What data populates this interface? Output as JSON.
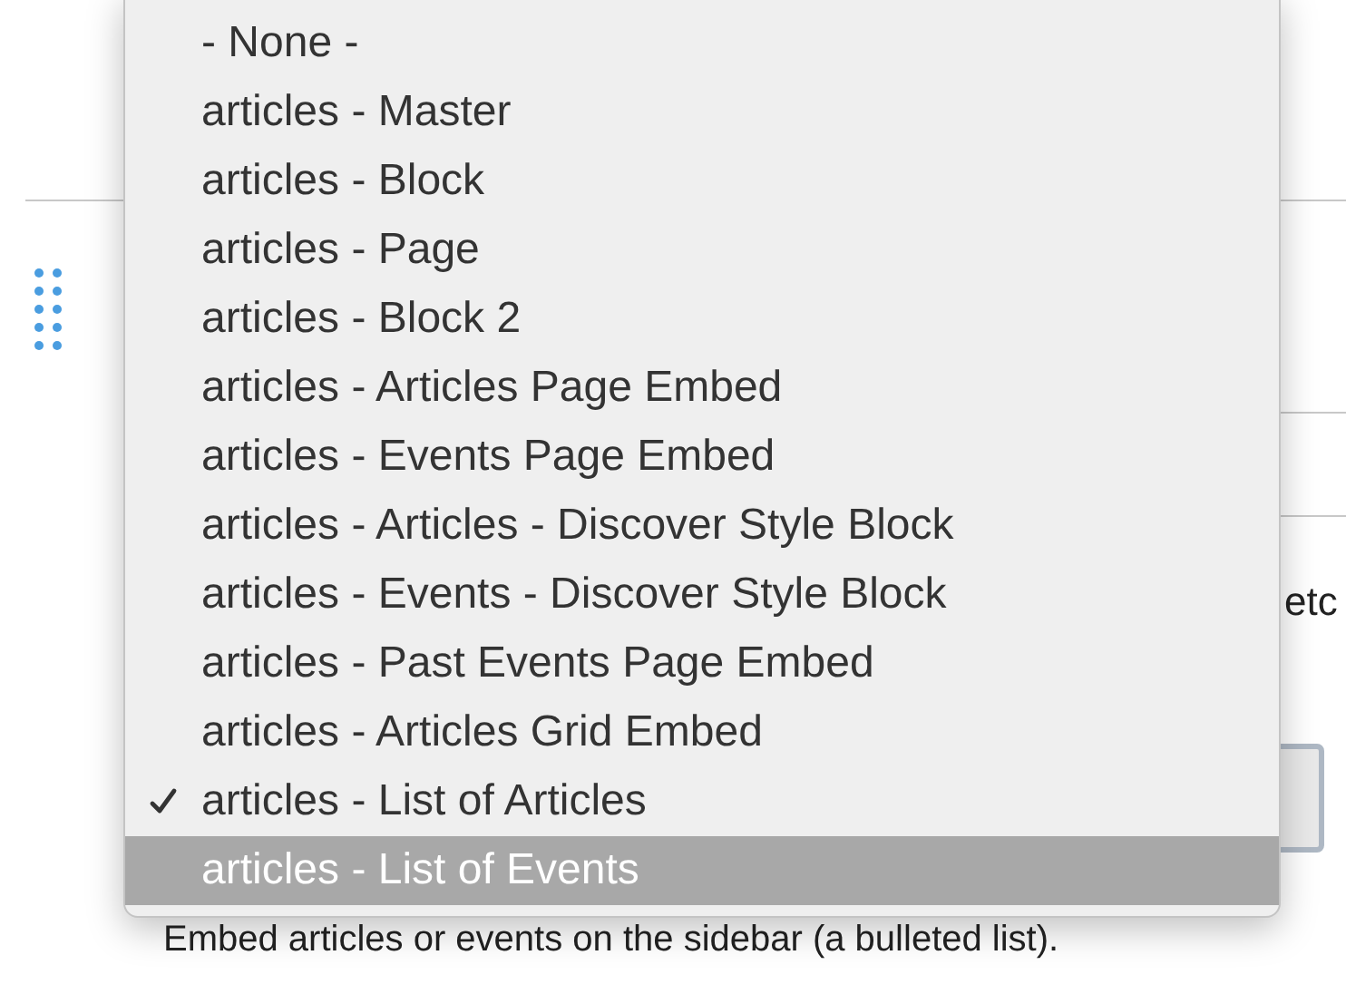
{
  "page": {
    "text_fragment": "etc",
    "description": "Embed articles or events on the sidebar (a bulleted list)."
  },
  "menu": {
    "items": [
      {
        "label": "- None -",
        "checked": false,
        "selected": false
      },
      {
        "label": "articles - Master",
        "checked": false,
        "selected": false
      },
      {
        "label": "articles - Block",
        "checked": false,
        "selected": false
      },
      {
        "label": "articles - Page",
        "checked": false,
        "selected": false
      },
      {
        "label": "articles - Block 2",
        "checked": false,
        "selected": false
      },
      {
        "label": "articles - Articles Page Embed",
        "checked": false,
        "selected": false
      },
      {
        "label": "articles - Events Page Embed",
        "checked": false,
        "selected": false
      },
      {
        "label": "articles - Articles - Discover Style Block",
        "checked": false,
        "selected": false
      },
      {
        "label": "articles - Events - Discover Style Block",
        "checked": false,
        "selected": false
      },
      {
        "label": "articles - Past Events Page Embed",
        "checked": false,
        "selected": false
      },
      {
        "label": "articles - Articles Grid Embed",
        "checked": false,
        "selected": false
      },
      {
        "label": "articles - List of Articles",
        "checked": true,
        "selected": false
      },
      {
        "label": "articles - List of Events",
        "checked": false,
        "selected": true
      }
    ]
  }
}
